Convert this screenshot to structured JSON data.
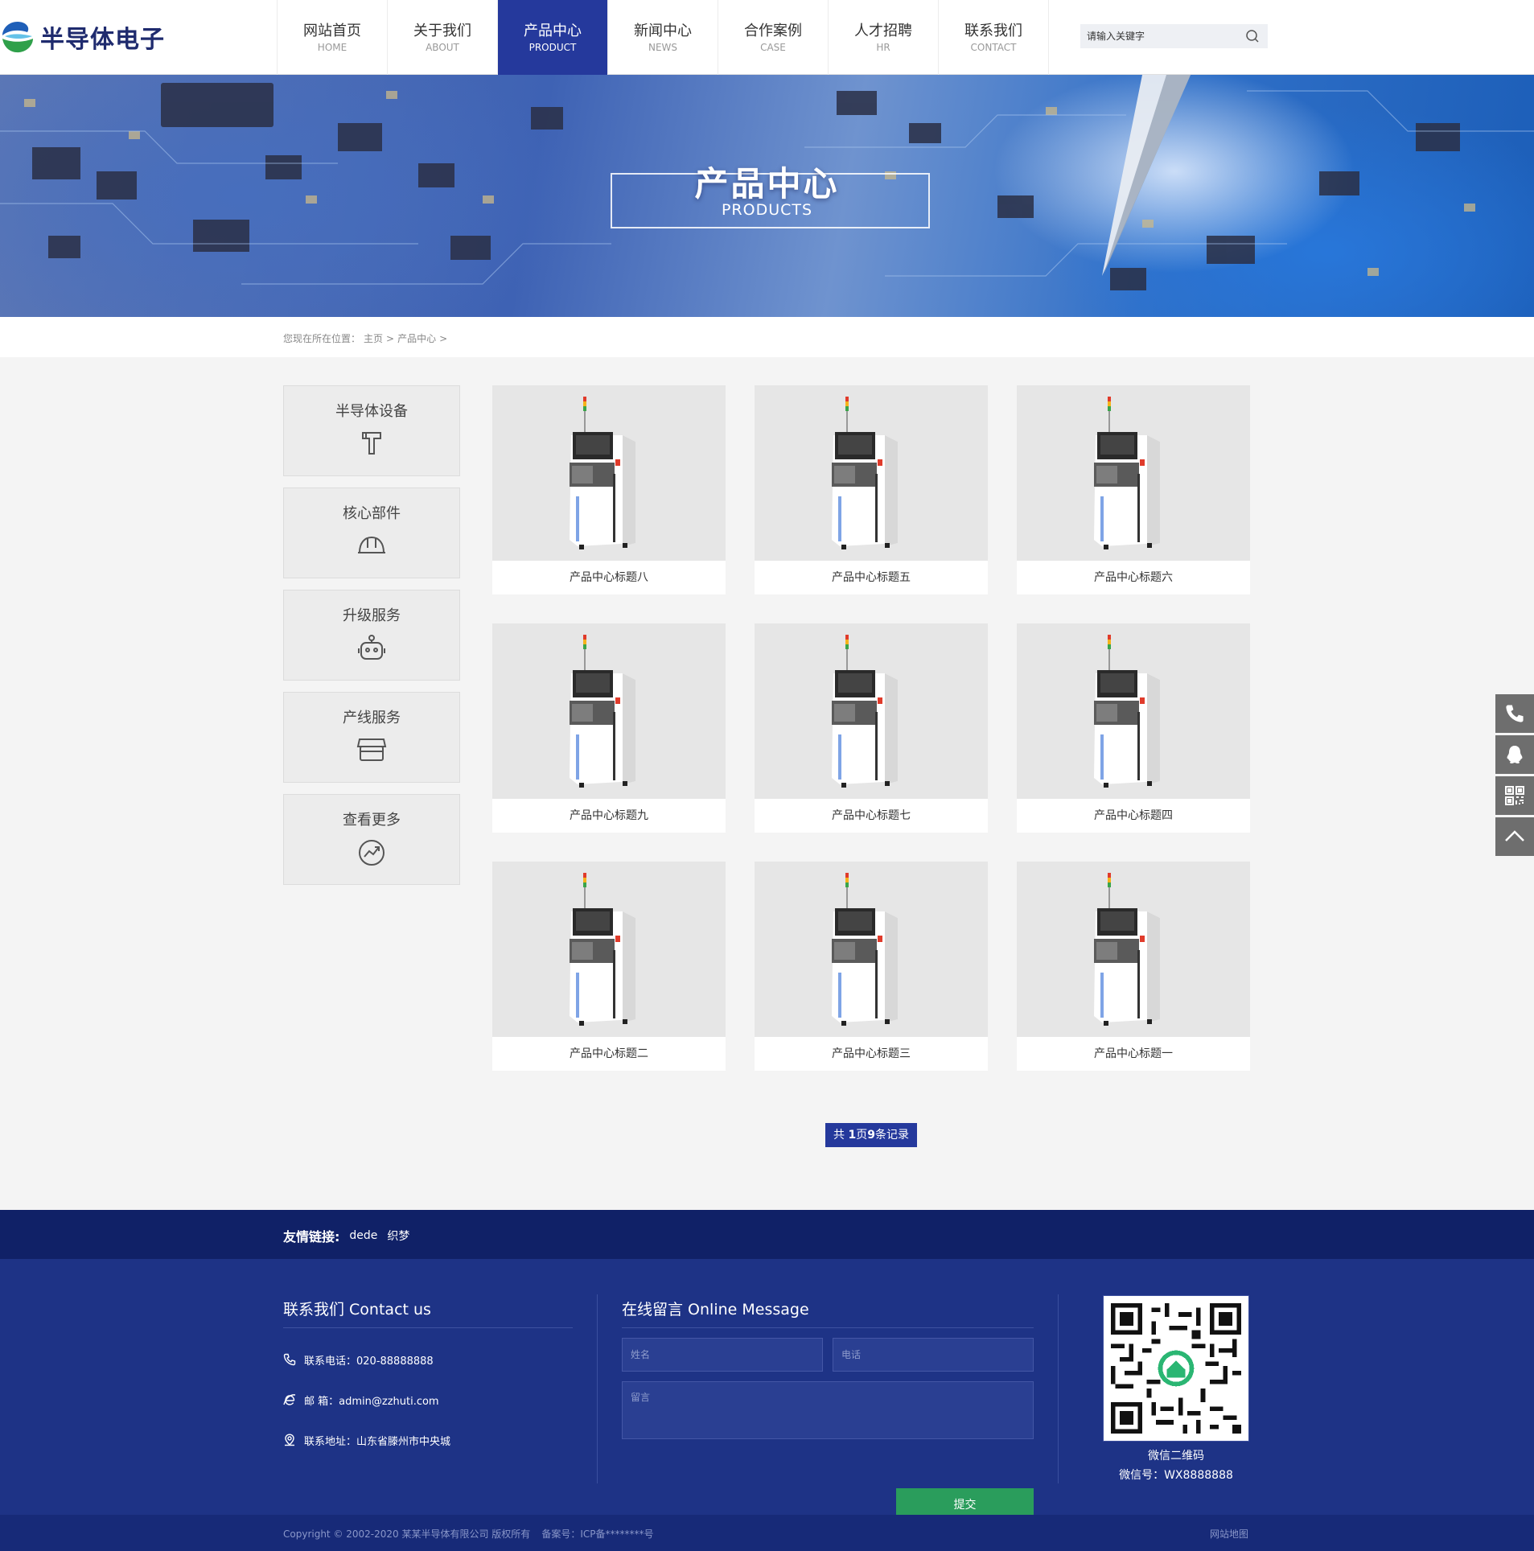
{
  "brand": {
    "name": "半导体电子"
  },
  "nav": [
    {
      "cn": "网站首页",
      "en": "HOME",
      "active": false
    },
    {
      "cn": "关于我们",
      "en": "ABOUT",
      "active": false
    },
    {
      "cn": "产品中心",
      "en": "PRODUCT",
      "active": true
    },
    {
      "cn": "新闻中心",
      "en": "NEWS",
      "active": false
    },
    {
      "cn": "合作案例",
      "en": "CASE",
      "active": false
    },
    {
      "cn": "人才招聘",
      "en": "HR",
      "active": false
    },
    {
      "cn": "联系我们",
      "en": "CONTACT",
      "active": false
    }
  ],
  "search": {
    "placeholder": "请输入关键字",
    "icon": "search-icon"
  },
  "banner": {
    "title": "产品中心",
    "subtitle": "PRODUCTS"
  },
  "breadcrumb": {
    "prefix": "您现在所在位置：",
    "home": "主页",
    "current": "产品中心",
    "separator": ">"
  },
  "sidebar": [
    {
      "label": "半导体设备",
      "icon": "hammer-icon"
    },
    {
      "label": "核心部件",
      "icon": "helmet-icon"
    },
    {
      "label": "升级服务",
      "icon": "robot-icon"
    },
    {
      "label": "产线服务",
      "icon": "store-icon"
    },
    {
      "label": "查看更多",
      "icon": "trend-icon"
    }
  ],
  "products": [
    {
      "title": "产品中心标题八"
    },
    {
      "title": "产品中心标题五"
    },
    {
      "title": "产品中心标题六"
    },
    {
      "title": "产品中心标题九"
    },
    {
      "title": "产品中心标题七"
    },
    {
      "title": "产品中心标题四"
    },
    {
      "title": "产品中心标题二"
    },
    {
      "title": "产品中心标题三"
    },
    {
      "title": "产品中心标题一"
    }
  ],
  "pager": {
    "prefix": "共 ",
    "pages": "1",
    "mid": "页",
    "records": "9",
    "suffix": "条记录"
  },
  "friend_links": {
    "label": "友情链接:",
    "items": [
      "dede",
      "织梦"
    ]
  },
  "contact": {
    "title": "联系我们 Contact us",
    "phone": "联系电话：020-88888888",
    "email": "邮 箱：admin@zzhuti.com",
    "address": "联系地址：山东省滕州市中央城"
  },
  "message": {
    "title": "在线留言 Online Message",
    "name_placeholder": "姓名",
    "phone_placeholder": "电话",
    "content_placeholder": "留言",
    "submit_label": "提交"
  },
  "qr": {
    "caption": "微信二维码",
    "wechat_id": "微信号：WX8888888"
  },
  "footer": {
    "copyright": "Copyright © 2002-2020 某某半导体有限公司 版权所有",
    "icp": "备案号：ICP备********号",
    "sitemap": "网站地图"
  },
  "float_tools": [
    "phone-icon",
    "qq-icon",
    "qrcode-icon",
    "back-to-top-icon"
  ],
  "colors": {
    "primary": "#25399c",
    "footer_bg": "#1e3386",
    "links_bar": "#102167",
    "submit": "#2a9d5c",
    "float_bg": "#6e6e6e"
  }
}
